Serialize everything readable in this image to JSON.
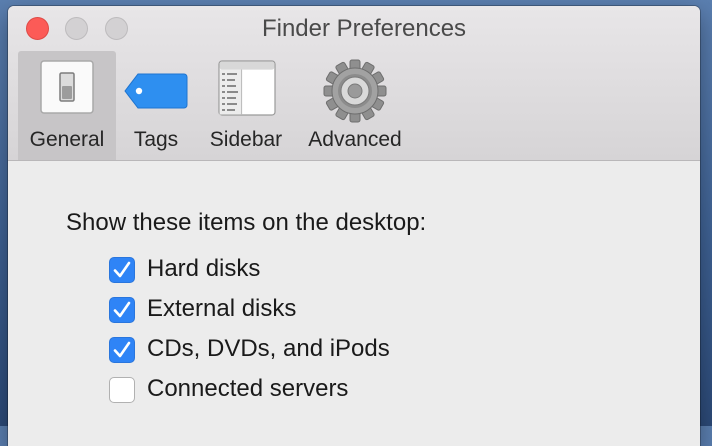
{
  "window": {
    "title": "Finder Preferences"
  },
  "toolbar": {
    "items": [
      {
        "label": "General",
        "icon": "general-switch-icon",
        "selected": true
      },
      {
        "label": "Tags",
        "icon": "tag-icon",
        "selected": false
      },
      {
        "label": "Sidebar",
        "icon": "sidebar-icon",
        "selected": false
      },
      {
        "label": "Advanced",
        "icon": "gear-icon",
        "selected": false
      }
    ]
  },
  "general": {
    "heading": "Show these items on the desktop:",
    "options": [
      {
        "label": "Hard disks",
        "checked": true
      },
      {
        "label": "External disks",
        "checked": true
      },
      {
        "label": "CDs, DVDs, and iPods",
        "checked": true
      },
      {
        "label": "Connected servers",
        "checked": false
      }
    ]
  },
  "colors": {
    "accent": "#2f84f6",
    "close": "#fc5b57",
    "tag": "#2e8ff0"
  }
}
